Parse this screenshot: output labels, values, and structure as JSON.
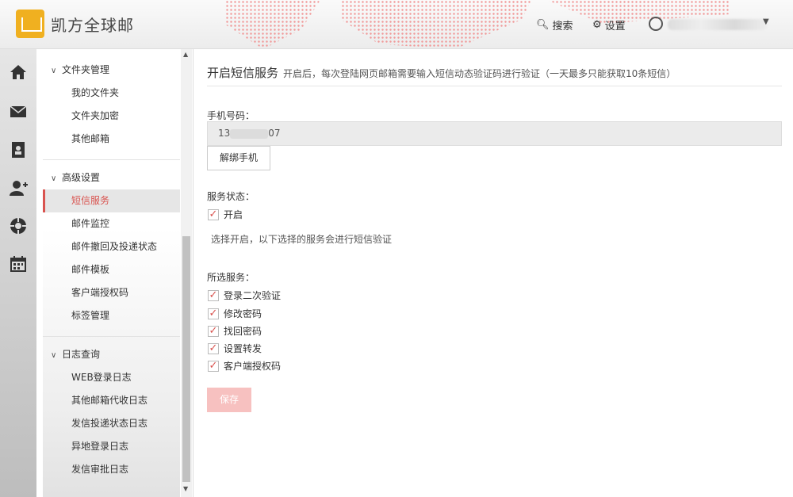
{
  "header": {
    "app_name": "凯方全球邮",
    "search_label": "搜索",
    "settings_label": "设置"
  },
  "rail": {
    "icons": [
      "home-icon",
      "mail-icon",
      "contacts-icon",
      "add-user-icon",
      "target-icon",
      "calendar-icon"
    ]
  },
  "nav": {
    "groups": [
      {
        "label": "文件夹管理",
        "items": [
          "我的文件夹",
          "文件夹加密",
          "其他邮箱"
        ]
      },
      {
        "label": "高级设置",
        "items": [
          "短信服务",
          "邮件监控",
          "邮件撤回及投递状态",
          "邮件模板",
          "客户端授权码",
          "标签管理"
        ]
      },
      {
        "label": "日志查询",
        "items": [
          "WEB登录日志",
          "其他邮箱代收日志",
          "发信投递状态日志",
          "异地登录日志",
          "发信审批日志"
        ]
      }
    ],
    "active_item": "短信服务"
  },
  "main": {
    "title": "开启短信服务",
    "subtitle": "开启后，每次登陆网页邮箱需要输入短信动态验证码进行验证（一天最多只能获取10条短信）",
    "phone_label": "手机号码：",
    "phone_prefix": "13",
    "phone_suffix": "07",
    "unbind_label": "解绑手机",
    "status_label": "服务状态：",
    "enable_label": "开启",
    "enable_checked": true,
    "enable_note": "选择开启，以下选择的服务会进行短信验证",
    "services_label": "所选服务：",
    "services": [
      {
        "label": "登录二次验证",
        "checked": true
      },
      {
        "label": "修改密码",
        "checked": true
      },
      {
        "label": "找回密码",
        "checked": true
      },
      {
        "label": "设置转发",
        "checked": true
      },
      {
        "label": "客户端授权码",
        "checked": true
      }
    ],
    "save_label": "保存"
  },
  "colors": {
    "accent": "#d9534f",
    "save_disabled": "#f7c1c0",
    "logo": "#f0b020"
  }
}
